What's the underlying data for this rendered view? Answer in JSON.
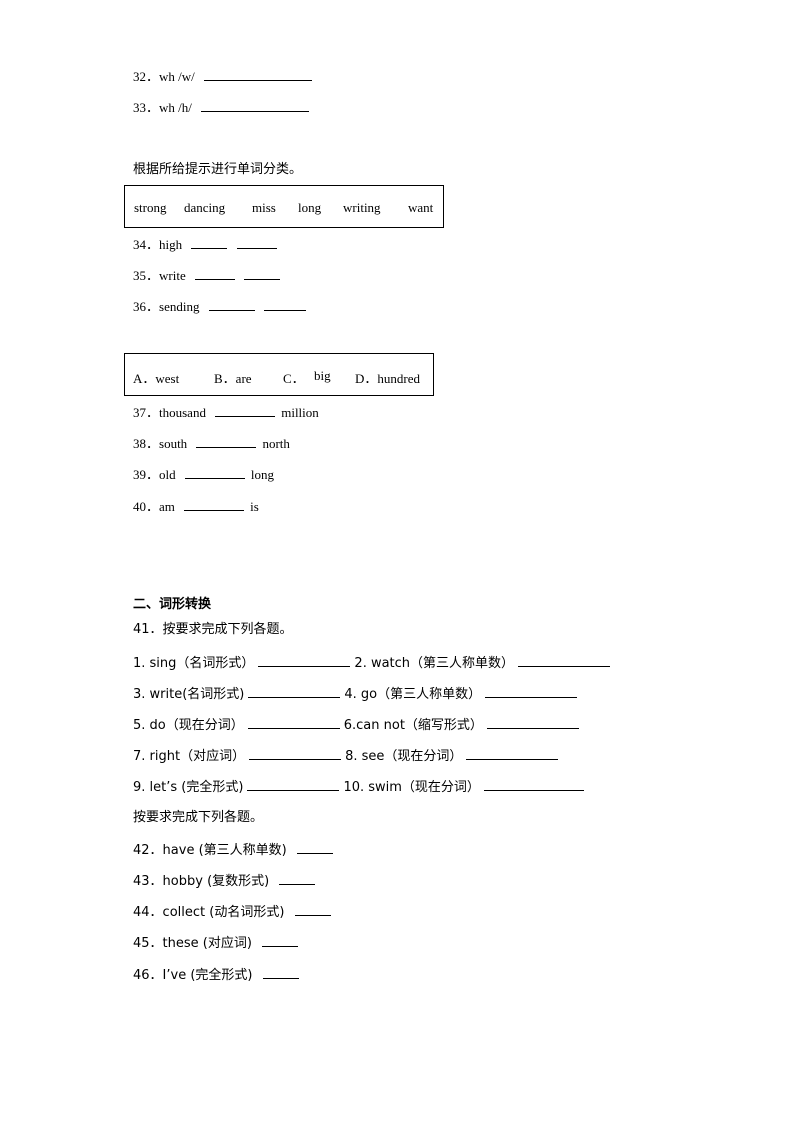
{
  "sound_items": [
    {
      "num": "32．",
      "text": "wh /w/"
    },
    {
      "num": "33．",
      "text": "wh /h/"
    }
  ],
  "classify": {
    "instruction": "根据所给提示进行单词分类。",
    "word_box": [
      "strong",
      "dancing",
      "miss",
      "long",
      "writing",
      "want"
    ],
    "items": [
      {
        "num": "34．",
        "text": "high"
      },
      {
        "num": "35．",
        "text": "write"
      },
      {
        "num": "36．",
        "text": "sending"
      }
    ]
  },
  "choice": {
    "options": [
      "A．west",
      "B．are",
      "C．",
      "big",
      "D．hundred"
    ],
    "items": [
      {
        "num": "37．",
        "before": "thousand",
        "after": "million"
      },
      {
        "num": "38．",
        "before": "south",
        "after": "north"
      },
      {
        "num": "39．",
        "before": "old",
        "after": "long"
      },
      {
        "num": "40．",
        "before": "am",
        "after": "is"
      }
    ]
  },
  "section2": {
    "heading": "二、词形转换",
    "q41": "41．按要求完成下列各题。",
    "pairs": [
      [
        "1. sing（名词形式）",
        "2. watch（第三人称单数）"
      ],
      [
        "3. write(名词形式)",
        "4. go（第三人称单数）"
      ],
      [
        "5. do（现在分词）",
        "6.can not（缩写形式）"
      ],
      [
        "7. right（对应词）",
        "8. see（现在分词）"
      ],
      [
        "9. let’s (完全形式)",
        "10. swim（现在分词）"
      ]
    ],
    "instruction2": "按要求完成下列各题。",
    "items": [
      {
        "num": "42．",
        "text": "have (第三人称单数)"
      },
      {
        "num": "43．",
        "text": "hobby (复数形式)"
      },
      {
        "num": "44．",
        "text": "collect (动名词形式)"
      },
      {
        "num": "45．",
        "text": "these (对应词)"
      },
      {
        "num": "46．",
        "text": "I’ve (完全形式)"
      }
    ]
  }
}
